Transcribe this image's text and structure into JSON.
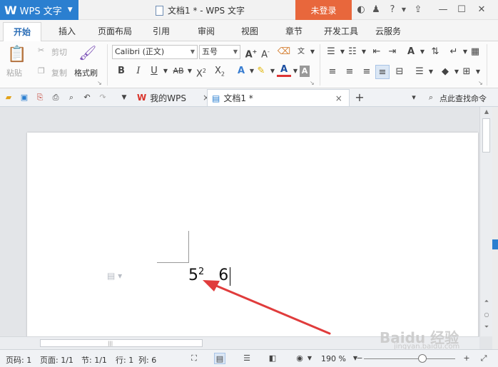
{
  "titlebar": {
    "app_logo": "W",
    "app_name": "WPS 文字",
    "doc_title": "文档1 * - WPS 文字",
    "login_label": "未登录",
    "icons": [
      "skin-icon",
      "shirt-icon",
      "help-icon",
      "share-icon",
      "minimize-icon",
      "maximize-icon",
      "close-icon"
    ]
  },
  "tabs": [
    "开始",
    "插入",
    "页面布局",
    "引用",
    "审阅",
    "视图",
    "章节",
    "开发工具",
    "云服务"
  ],
  "ribbon": {
    "paste": "粘贴",
    "cut": "剪切",
    "copy": "复制",
    "format_painter": "格式刷",
    "font_name": "Calibri (正文)",
    "font_size": "五号"
  },
  "doc_tabs": {
    "home_tab": "我的WPS",
    "doc_tab": "文档1 *",
    "find_command": "点此查找命令"
  },
  "document": {
    "base": "5",
    "superscript": "2",
    "next_char": "6"
  },
  "watermark": {
    "main": "Baidu 经验",
    "sub": "jingyan.baidu.com"
  },
  "status": {
    "page_num": "页码: 1",
    "page": "页面: 1/1",
    "section": "节: 1/1",
    "row": "行: 1",
    "col": "列: 6",
    "zoom": "190 %"
  },
  "colors": {
    "accent": "#2b7fd0",
    "login_bg": "#e8673c",
    "arrow": "#e03c3c"
  }
}
